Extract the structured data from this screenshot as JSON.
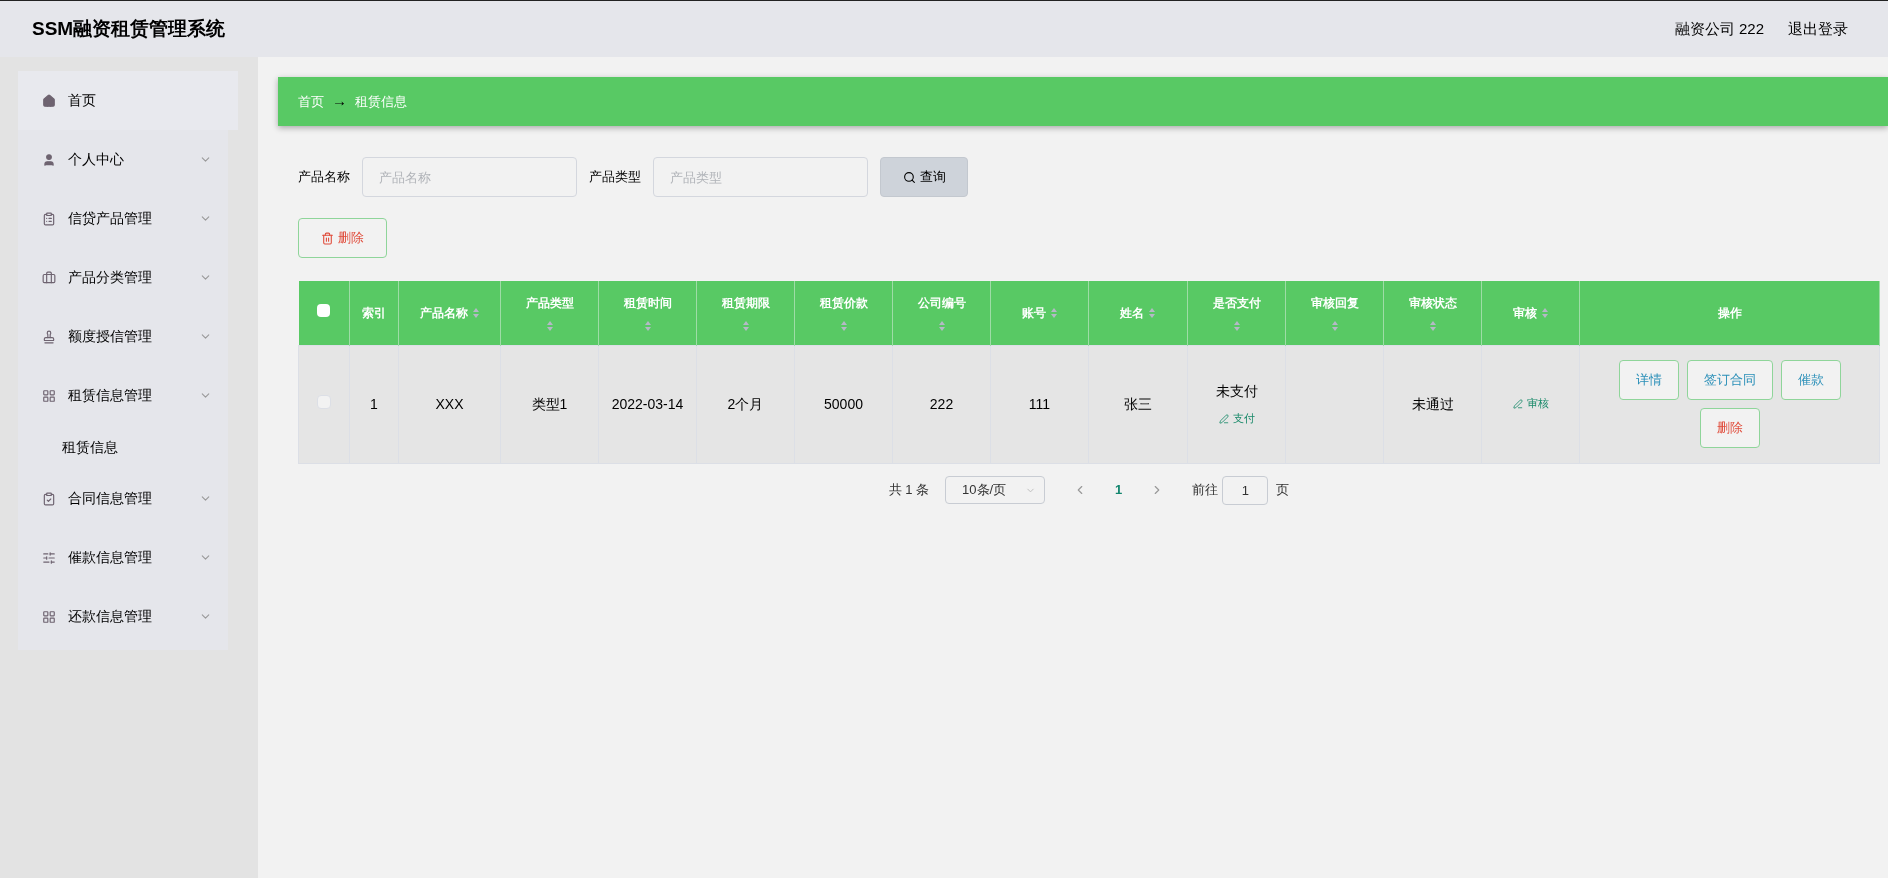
{
  "header": {
    "title": "SSM融资租赁管理系统",
    "user": "融资公司 222",
    "logout": "退出登录"
  },
  "sidebar": {
    "items": [
      {
        "label": "首页",
        "expandable": false,
        "selected": true
      },
      {
        "label": "个人中心",
        "expandable": true,
        "selected": false
      },
      {
        "label": "信贷产品管理",
        "expandable": true,
        "selected": false
      },
      {
        "label": "产品分类管理",
        "expandable": true,
        "selected": false
      },
      {
        "label": "额度授信管理",
        "expandable": true,
        "selected": false
      },
      {
        "label": "租赁信息管理",
        "expandable": true,
        "selected": false,
        "children": [
          {
            "label": "租赁信息",
            "selected": false
          }
        ]
      },
      {
        "label": "合同信息管理",
        "expandable": true,
        "selected": false
      },
      {
        "label": "催款信息管理",
        "expandable": true,
        "selected": false
      },
      {
        "label": "还款信息管理",
        "expandable": true,
        "selected": false
      }
    ]
  },
  "breadcrumb": [
    "首页",
    "→",
    "租赁信息"
  ],
  "filters": [
    {
      "label": "产品名称",
      "placeholder": "产品名称"
    },
    {
      "label": "产品类型",
      "placeholder": "产品类型"
    }
  ],
  "search_button": "查询",
  "delete_button": "删除",
  "table": {
    "select_all": {
      "checked": false
    },
    "columns": [
      {
        "label": "索引",
        "sortable": false
      },
      {
        "label": "产品名称",
        "sortable": true
      },
      {
        "label": "产品类型",
        "sortable": true
      },
      {
        "label": "租赁时间",
        "sortable": true
      },
      {
        "label": "租赁期限",
        "sortable": true
      },
      {
        "label": "租赁价款",
        "sortable": true
      },
      {
        "label": "公司编号",
        "sortable": true
      },
      {
        "label": "账号",
        "sortable": true
      },
      {
        "label": "姓名",
        "sortable": true
      },
      {
        "label": "是否支付",
        "sortable": true
      },
      {
        "label": "审核回复",
        "sortable": true
      },
      {
        "label": "审核状态",
        "sortable": true
      },
      {
        "label": "审核",
        "sortable": true
      },
      {
        "label": "操作",
        "sortable": false
      }
    ],
    "rows": [
      {
        "checked": false,
        "cells": [
          "1",
          "XXX",
          "类型1",
          "2022-03-14",
          "2个月",
          "50000",
          "222",
          "111",
          "张三"
        ],
        "payment_status": "未支付",
        "pay_action": "支付",
        "review_status": "未通过",
        "review_action": "审核",
        "actions": [
          {
            "label": "详情",
            "kind": "primary"
          },
          {
            "label": "签订合同",
            "kind": "primary"
          },
          {
            "label": "催款",
            "kind": "primary"
          },
          {
            "label": "删除",
            "kind": "danger"
          }
        ]
      }
    ]
  },
  "pagination": {
    "total": "共 1 条",
    "page_size": "10条/页",
    "pages": [
      {
        "label": "1",
        "selected": true
      }
    ],
    "goto_label": "前往",
    "goto_value": "1",
    "page_suffix": "页"
  }
}
